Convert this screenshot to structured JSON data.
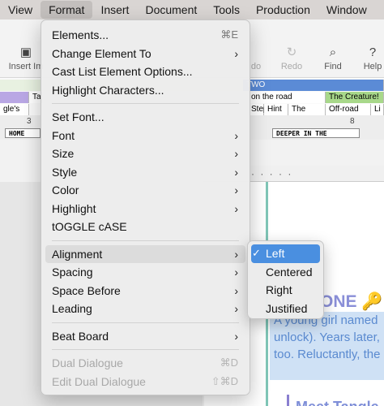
{
  "menubar": {
    "items": [
      "View",
      "Format",
      "Insert",
      "Document",
      "Tools",
      "Production",
      "Window"
    ]
  },
  "toolbar": {
    "insert_label": "Insert Im",
    "undo_label": "do",
    "redo_label": "Redo",
    "find_label": "Find",
    "help_label": "Help"
  },
  "timeline": {
    "row1": [
      "TWO"
    ],
    "row2": [
      "Ta",
      "on the road",
      "The Creature!"
    ],
    "row3": [
      "gle's",
      "Step",
      "Hint",
      "The",
      "Off-road",
      "Li"
    ],
    "ruler_nums": [
      "3",
      "8"
    ],
    "scenes": [
      "HOME",
      "DEEPER IN THE"
    ]
  },
  "document": {
    "heading": "ONE 🔑",
    "synopsis_lines": [
      "A young girl named",
      "unlock). Years later,",
      "too. Reluctantly, the"
    ],
    "meet": "Meet Tangle"
  },
  "format_menu": {
    "items": [
      {
        "label": "Elements...",
        "shortcut": "⌘E"
      },
      {
        "label": "Change Element To",
        "arrow": "›"
      },
      {
        "label": "Cast List Element Options..."
      },
      {
        "label": "Highlight Characters..."
      },
      {
        "label": "Set Font..."
      },
      {
        "label": "Font",
        "arrow": "›"
      },
      {
        "label": "Size",
        "arrow": "›"
      },
      {
        "label": "Style",
        "arrow": "›"
      },
      {
        "label": "Color",
        "arrow": "›"
      },
      {
        "label": "Highlight",
        "arrow": "›"
      },
      {
        "label": "tOGGLE cASE"
      },
      {
        "label": "Alignment",
        "arrow": "›"
      },
      {
        "label": "Spacing",
        "arrow": "›"
      },
      {
        "label": "Space Before",
        "arrow": "›"
      },
      {
        "label": "Leading",
        "arrow": "›"
      },
      {
        "label": "Beat Board",
        "arrow": "›"
      },
      {
        "label": "Dual Dialogue",
        "shortcut": "⌘D"
      },
      {
        "label": "Edit Dual Dialogue",
        "shortcut": "⇧⌘D"
      }
    ]
  },
  "alignment_submenu": {
    "items": [
      {
        "label": "Left",
        "check": "✓"
      },
      {
        "label": "Centered"
      },
      {
        "label": "Right"
      },
      {
        "label": "Justified"
      }
    ]
  },
  "colors": {
    "selection": "#4a8fe0",
    "menubar_bg": "#d9d5d3"
  }
}
